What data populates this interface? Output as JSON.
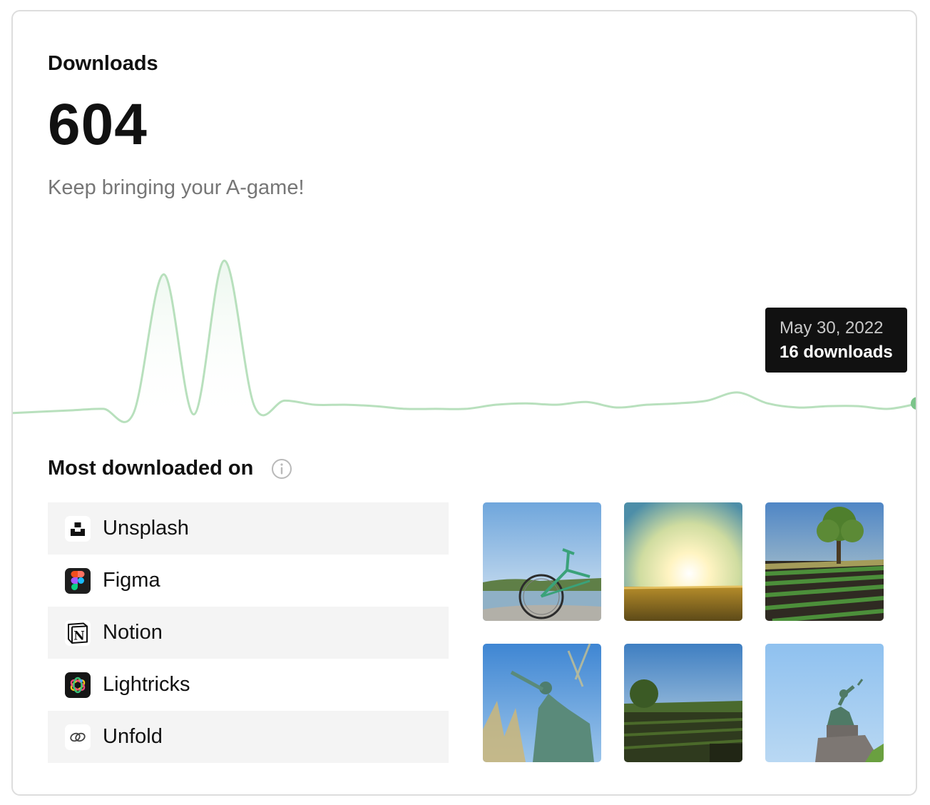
{
  "card": {
    "title": "Downloads",
    "count": "604",
    "subtitle": "Keep bringing your A-game!"
  },
  "tooltip": {
    "date": "May 30, 2022",
    "value": "16 downloads"
  },
  "colors": {
    "line": "#b8e0bd",
    "fill_top": "#eaf6ec",
    "dot": "#7cc48a",
    "tooltip_bg": "#111111",
    "row_shade": "#f4f4f4"
  },
  "chart_data": {
    "type": "area",
    "title": "",
    "xlabel": "",
    "ylabel": "",
    "grid": false,
    "highlight": {
      "x": "May 30, 2022",
      "y": 16
    },
    "x": [
      0,
      1,
      2,
      3,
      4,
      5,
      6,
      7,
      8,
      9,
      10,
      11,
      12,
      13,
      14,
      15,
      16,
      17,
      18,
      19,
      20,
      21,
      22,
      23,
      24,
      25,
      26,
      27,
      28,
      29,
      30
    ],
    "values": [
      9,
      10,
      11,
      12,
      9,
      110,
      8,
      120,
      14,
      18,
      15,
      15,
      14,
      12,
      12,
      12,
      15,
      16,
      15,
      17,
      13,
      15,
      16,
      18,
      24,
      16,
      13,
      14,
      14,
      12,
      16
    ],
    "ylim": [
      0,
      130
    ]
  },
  "most_downloaded": {
    "title": "Most downloaded on",
    "info_icon": "info-icon",
    "platforms": [
      {
        "label": "Unsplash",
        "icon": "unsplash-logo-icon"
      },
      {
        "label": "Figma",
        "icon": "figma-logo-icon"
      },
      {
        "label": "Notion",
        "icon": "notion-logo-icon"
      },
      {
        "label": "Lightricks",
        "icon": "lightricks-logo-icon"
      },
      {
        "label": "Unfold",
        "icon": "unfold-logo-icon"
      }
    ]
  },
  "photos": [
    {
      "subject": "bicycle by a lake under blue sky"
    },
    {
      "subject": "sunset over a grassy field"
    },
    {
      "subject": "tree over rows of crops"
    },
    {
      "subject": "equestrian statue among dry grass"
    },
    {
      "subject": "farm field with trees and sky"
    },
    {
      "subject": "equestrian statue against blue sky"
    }
  ]
}
